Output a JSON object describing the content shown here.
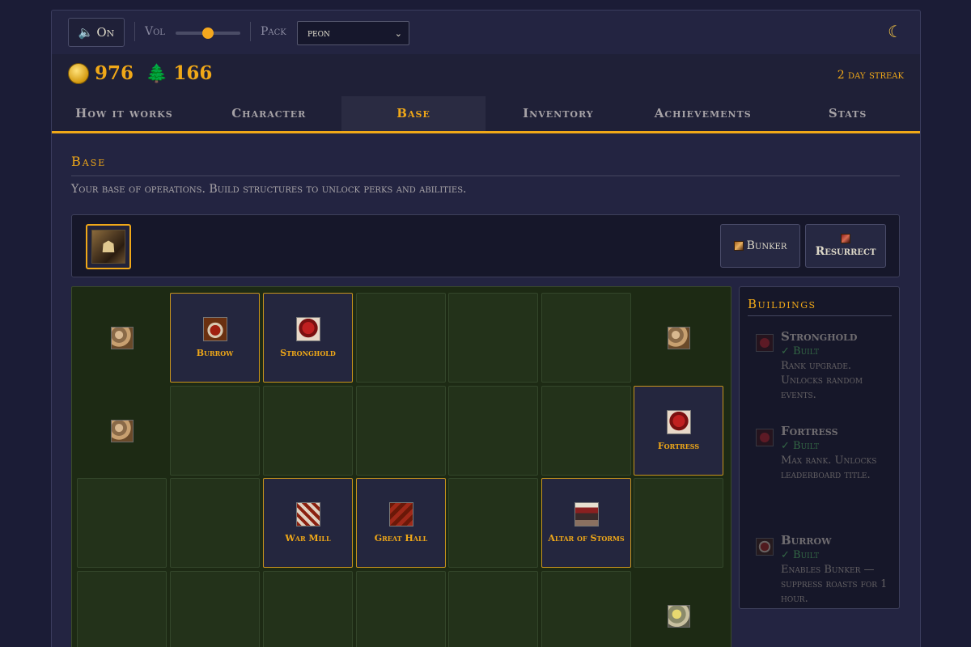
{
  "topbar": {
    "sound_icon": "speaker-icon",
    "sound_label": "On",
    "volume_label": "Vol",
    "volume_level": 0.5,
    "pack_label": "Pack",
    "pack_value": "peon",
    "theme_icon": "moon-icon"
  },
  "resources": {
    "gold": "976",
    "lumber": "166",
    "streak": "2 day streak"
  },
  "tabs": [
    "How it works",
    "Character",
    "Base",
    "Inventory",
    "Achievements",
    "Stats"
  ],
  "active_tab": "Base",
  "section": {
    "title": "Base",
    "description": "Your base of operations. Build structures to unlock perks and abilities."
  },
  "actions": {
    "bunker_label": "Bunker",
    "resurrect_label": "Resurrect"
  },
  "grid": {
    "burrow": "Burrow",
    "stronghold": "Stronghold",
    "fortress": "Fortress",
    "war_mill": "War Mill",
    "great_hall": "Great Hall",
    "altar": "Altar of Storms"
  },
  "panel": {
    "title": "Buildings",
    "entries": [
      {
        "name": "Stronghold",
        "status": "✓ Built",
        "desc": "Rank upgrade. Unlocks random events."
      },
      {
        "name": "Fortress",
        "status": "✓ Built",
        "desc": "Max rank. Unlocks leaderboard title."
      },
      {
        "name": "Burrow",
        "status": "✓ Built",
        "desc": "Enables Bunker — suppress roasts for 1 hour."
      }
    ]
  },
  "colors": {
    "accent": "#f0a818",
    "background": "#1b1c36",
    "grass": "#23321a",
    "built_status": "#5ad06a"
  }
}
